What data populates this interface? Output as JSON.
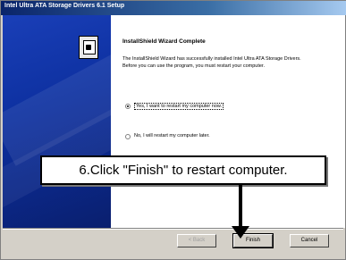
{
  "window": {
    "title": "Intel Ultra ATA Storage Drivers 6.1 Setup"
  },
  "wizard": {
    "heading": "InstallShield Wizard Complete",
    "body": "The InstallShield Wizard has successfully installed Intel Ultra ATA Storage Drivers. Before you can use the program, you must restart your computer.",
    "option_yes": "Yes, I want to restart my computer now.",
    "option_no": "No, I will restart my computer later."
  },
  "buttons": {
    "back": "< Back",
    "finish": "Finish",
    "cancel": "Cancel"
  },
  "annotation": {
    "text": "6.Click \"Finish\" to restart computer."
  },
  "colors": {
    "titlebar": "#0a246a",
    "left_panel": "#0c2f9e",
    "dialog_face": "#d4d0c8"
  },
  "icons": {
    "app_icon": "installer-icon",
    "arrow": "down-arrow-icon"
  }
}
